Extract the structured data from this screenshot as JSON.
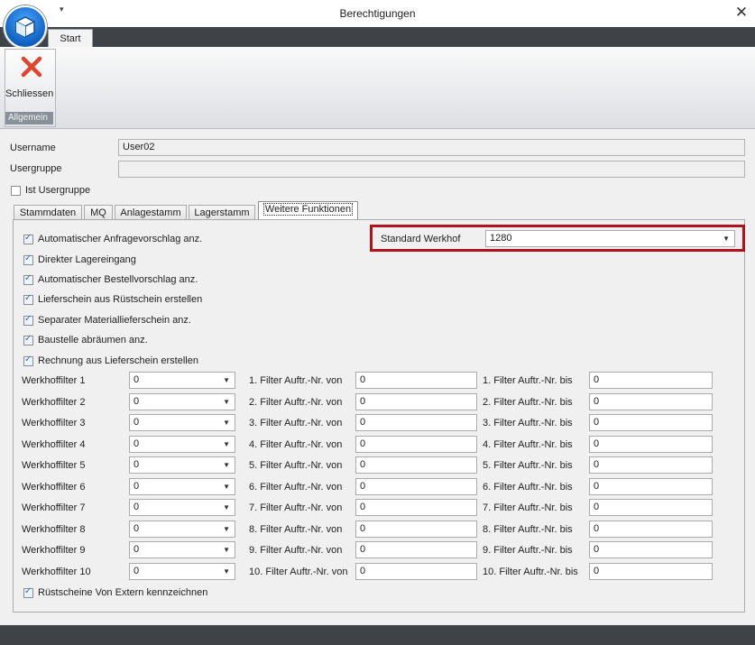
{
  "window": {
    "title": "Berechtigungen",
    "close_glyph": "✕",
    "qa_glyph": "▾"
  },
  "ribbon": {
    "tabs": [
      "Start"
    ],
    "close_button_label": "Schliessen",
    "group_label": "Allgemein"
  },
  "form": {
    "username_label": "Username",
    "username_value": "User02",
    "usergroup_label": "Usergruppe",
    "usergroup_value": "",
    "is_usergroup_label": "Ist Usergruppe",
    "is_usergroup_checked": false
  },
  "tabs": [
    "Stammdaten",
    "MQ",
    "Anlagestamm",
    "Lagerstamm",
    "Weitere Funktionen"
  ],
  "active_tab": "Weitere Funktionen",
  "options": [
    {
      "label": "Automatischer Anfragevorschlag anz.",
      "checked": true
    },
    {
      "label": "Direkter Lagereingang",
      "checked": true
    },
    {
      "label": "Automatischer Bestellvorschlag anz.",
      "checked": true
    },
    {
      "label": "Lieferschein aus Rüstschein erstellen",
      "checked": true
    },
    {
      "label": "Separater Materiallieferschein anz.",
      "checked": true
    },
    {
      "label": "Baustelle abräumen anz.",
      "checked": true
    },
    {
      "label": "Rechnung aus Lieferschein erstellen",
      "checked": true
    }
  ],
  "standard_werkhof": {
    "label": "Standard Werkhof",
    "value": "1280"
  },
  "filters": [
    {
      "label": "Werkhoffilter 1",
      "value": "0",
      "from_label": "1. Filter Auftr.-Nr. von",
      "from_value": "0",
      "to_label": "1. Filter Auftr.-Nr. bis",
      "to_value": "0"
    },
    {
      "label": "Werkhoffilter 2",
      "value": "0",
      "from_label": "2. Filter Auftr.-Nr. von",
      "from_value": "0",
      "to_label": "2. Filter Auftr.-Nr. bis",
      "to_value": "0"
    },
    {
      "label": "Werkhoffilter 3",
      "value": "0",
      "from_label": "3. Filter Auftr.-Nr. von",
      "from_value": "0",
      "to_label": "3. Filter Auftr.-Nr. bis",
      "to_value": "0"
    },
    {
      "label": "Werkhoffilter 4",
      "value": "0",
      "from_label": "4. Filter Auftr.-Nr. von",
      "from_value": "0",
      "to_label": "4. Filter Auftr.-Nr. bis",
      "to_value": "0"
    },
    {
      "label": "Werkhoffilter 5",
      "value": "0",
      "from_label": "5. Filter Auftr.-Nr. von",
      "from_value": "0",
      "to_label": "5. Filter Auftr.-Nr. bis",
      "to_value": "0"
    },
    {
      "label": "Werkhoffilter 6",
      "value": "0",
      "from_label": "6. Filter Auftr.-Nr. von",
      "from_value": "0",
      "to_label": "6. Filter Auftr.-Nr. bis",
      "to_value": "0"
    },
    {
      "label": "Werkhoffilter 7",
      "value": "0",
      "from_label": "7. Filter Auftr.-Nr. von",
      "from_value": "0",
      "to_label": "7. Filter Auftr.-Nr. bis",
      "to_value": "0"
    },
    {
      "label": "Werkhoffilter 8",
      "value": "0",
      "from_label": "8. Filter Auftr.-Nr. von",
      "from_value": "0",
      "to_label": "8. Filter Auftr.-Nr. bis",
      "to_value": "0"
    },
    {
      "label": "Werkhoffilter 9",
      "value": "0",
      "from_label": "9. Filter Auftr.-Nr. von",
      "from_value": "0",
      "to_label": "9. Filter Auftr.-Nr. bis",
      "to_value": "0"
    },
    {
      "label": "Werkhoffilter 10",
      "value": "0",
      "from_label": "10. Filter Auftr.-Nr. von",
      "from_value": "0",
      "to_label": "10. Filter Auftr.-Nr. bis",
      "to_value": "0"
    }
  ],
  "extern_option": {
    "label": "Rüstscheine Von Extern kennzeichnen",
    "checked": true
  },
  "colors": {
    "highlight": "#b3111b",
    "accent": "#2a78d6",
    "close_icon": "#e0462f"
  }
}
